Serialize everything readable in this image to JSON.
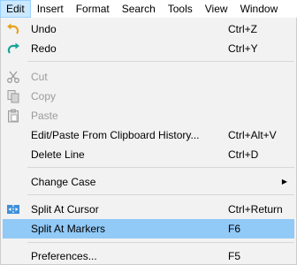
{
  "menubar": [
    {
      "label": "Edit",
      "active": true
    },
    {
      "label": "Insert"
    },
    {
      "label": "Format"
    },
    {
      "label": "Search"
    },
    {
      "label": "Tools"
    },
    {
      "label": "View"
    },
    {
      "label": "Window"
    }
  ],
  "menu": {
    "undo": {
      "label": "Undo",
      "shortcut": "Ctrl+Z",
      "icon": "undo-icon"
    },
    "redo": {
      "label": "Redo",
      "shortcut": "Ctrl+Y",
      "icon": "redo-icon"
    },
    "cut": {
      "label": "Cut",
      "icon": "scissors-icon"
    },
    "copy": {
      "label": "Copy",
      "icon": "copy-icon"
    },
    "paste": {
      "label": "Paste",
      "icon": "clipboard-icon"
    },
    "paste_history": {
      "label": "Edit/Paste From Clipboard History...",
      "shortcut": "Ctrl+Alt+V"
    },
    "delete_line": {
      "label": "Delete Line",
      "shortcut": "Ctrl+D"
    },
    "change_case": {
      "label": "Change Case"
    },
    "split_cursor": {
      "label": "Split At Cursor",
      "shortcut": "Ctrl+Return",
      "icon": "split-icon"
    },
    "split_markers": {
      "label": "Split At Markers",
      "shortcut": "F6"
    },
    "preferences": {
      "label": "Preferences...",
      "shortcut": "F5"
    }
  },
  "colors": {
    "highlight": "#91c9f7",
    "menu_bg": "#f2f2f2",
    "undo": "#e8a11c",
    "redo": "#1aa39a"
  }
}
